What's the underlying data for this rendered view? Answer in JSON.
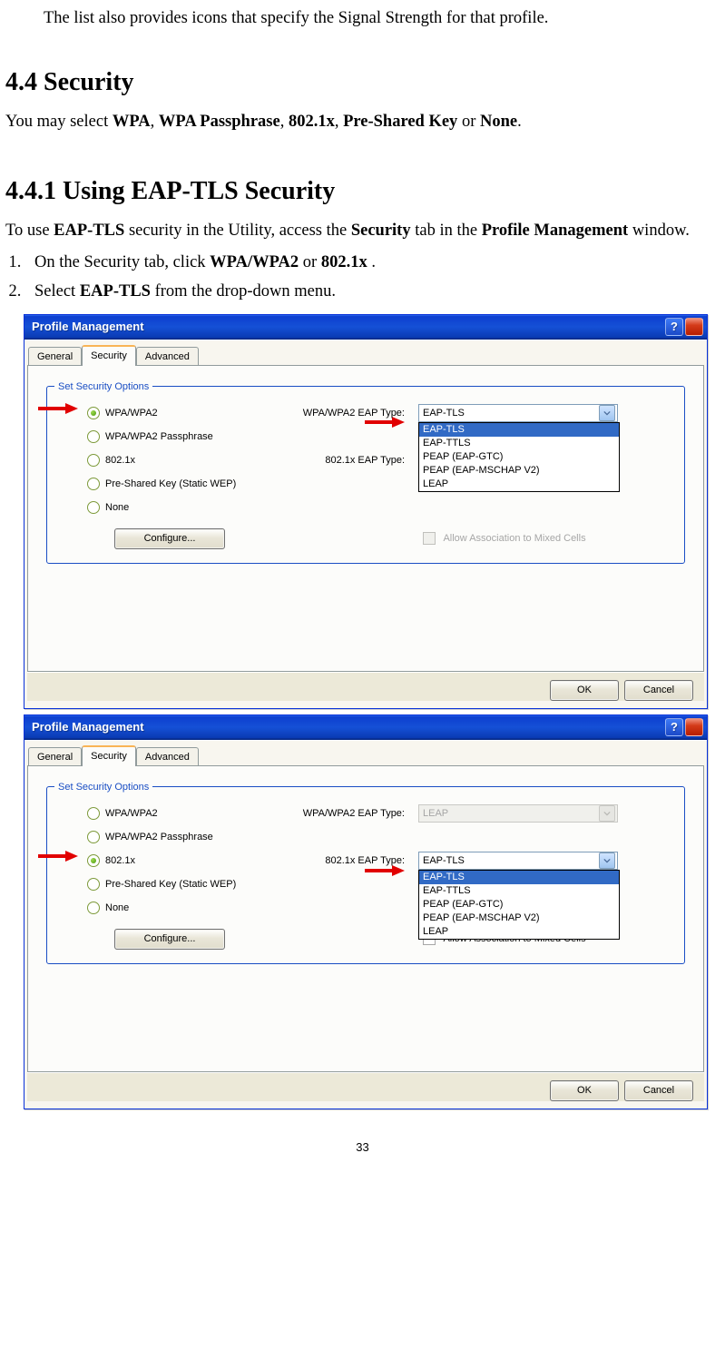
{
  "intro_line": "The list also provides icons that specify the Signal Strength for that profile.",
  "section_heading": "4.4 Security",
  "section_para_prefix": "You may select ",
  "opts": {
    "wpa": "WPA",
    "pass": "WPA Passphrase",
    "dot1x": "802.1x",
    "psk": "Pre-Shared Key",
    "none": "None"
  },
  "or_word": " or ",
  "period": ".",
  "comma": ", ",
  "subsection_heading": "4.4.1 Using EAP-TLS Security",
  "sub_para": {
    "p1": "To use ",
    "b1": "EAP-TLS",
    "p2": " security in the Utility, access the ",
    "b2": "Security",
    "p3": " tab in the ",
    "b3": "Profile Management",
    "p4": " window."
  },
  "steps": {
    "s1a": "On the Security tab, click ",
    "s1b1": "WPA/WPA2",
    "s1mid": " or ",
    "s1b2": "802.1x",
    "s1end": ".",
    "s2a": "Select ",
    "s2b": "EAP-TLS",
    "s2end": " from the drop-down menu."
  },
  "dialogA": {
    "title": "Profile Management",
    "tabs": {
      "general": "General",
      "security": "Security",
      "advanced": "Advanced"
    },
    "group_label": "Set Security Options",
    "radios": {
      "wpa": "WPA/WPA2",
      "pass": "WPA/WPA2 Passphrase",
      "dot1x": "802.1x",
      "psk": "Pre-Shared Key (Static WEP)",
      "none": "None"
    },
    "eap_labels": {
      "wpa": "WPA/WPA2 EAP Type:",
      "dot1x": "802.1x EAP Type:"
    },
    "combo_value": "EAP-TLS",
    "dropdown": [
      "EAP-TLS",
      "EAP-TTLS",
      "PEAP (EAP-GTC)",
      "PEAP (EAP-MSCHAP V2)",
      "LEAP"
    ],
    "configure": "Configure...",
    "mixed": "Allow Association to Mixed Cells",
    "ok": "OK",
    "cancel": "Cancel"
  },
  "dialogB": {
    "title": "Profile Management",
    "tabs": {
      "general": "General",
      "security": "Security",
      "advanced": "Advanced"
    },
    "group_label": "Set Security Options",
    "radios": {
      "wpa": "WPA/WPA2",
      "pass": "WPA/WPA2 Passphrase",
      "dot1x": "802.1x",
      "psk": "Pre-Shared Key (Static WEP)",
      "none": "None"
    },
    "eap_labels": {
      "wpa": "WPA/WPA2 EAP Type:",
      "dot1x": "802.1x EAP Type:"
    },
    "combo_wpa_value": "LEAP",
    "combo_dot1x_value": "EAP-TLS",
    "dropdown": [
      "EAP-TLS",
      "EAP-TTLS",
      "PEAP (EAP-GTC)",
      "PEAP (EAP-MSCHAP V2)",
      "LEAP"
    ],
    "configure": "Configure...",
    "mixed": "Allow Association to Mixed Cells",
    "ok": "OK",
    "cancel": "Cancel"
  },
  "page_number": "33"
}
